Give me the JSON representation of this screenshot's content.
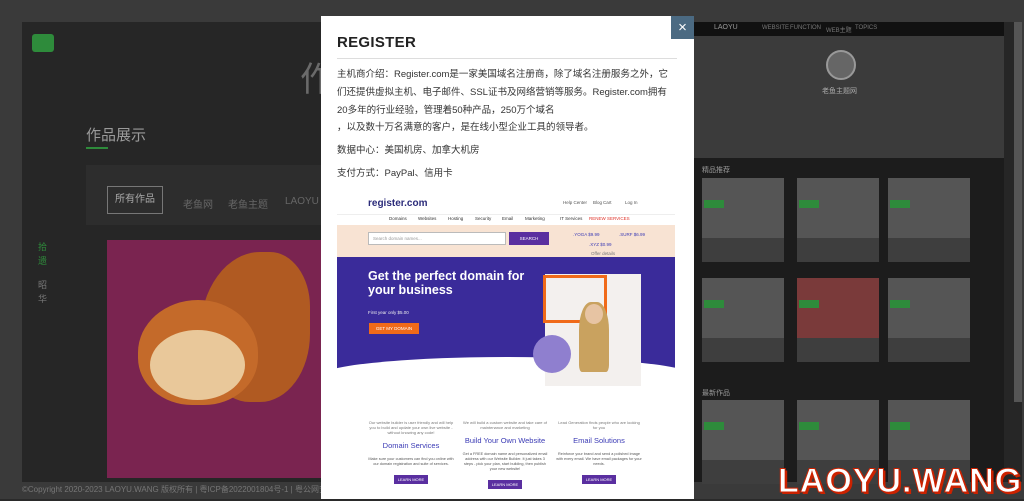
{
  "background": {
    "big_char": "作",
    "section_title": "作品展示",
    "filter": {
      "active": "所有作品",
      "items": [
        "老鱼网",
        "老鱼主题",
        "LAOYU"
      ]
    },
    "side_labels": [
      "拾",
      "遗",
      "昭",
      "华"
    ],
    "footer": "©Copyright 2020-2023 LAOYU.WANG 版权所有 | 粤ICP备2022001804号-1 | 粤公网安备 45070202000001号"
  },
  "right_site": {
    "logo": "LAOYU",
    "nav": [
      "WEBSITE",
      "FUNCTION",
      "WEB主题",
      "TOPICS"
    ],
    "profile_name": "老鱼主题网",
    "sections": [
      "精品推荐",
      "最新作品"
    ]
  },
  "modal": {
    "title": "REGISTER",
    "paragraphs": [
      "主机商介绍：Register.com是一家美国域名注册商，除了域名注册服务之外，它们还提供虚拟主机、电子邮件、SSL证书及网络营销等服务。Register.com拥有20多年的行业经验，管理着50种产品，250万个域名",
      "，以及数十万名满意的客户，是在线小型企业工具的领导者。",
      "数据中心：美国机房、加拿大机房",
      "支付方式：PayPal、信用卡"
    ],
    "close_label": "×"
  },
  "shot": {
    "logo": "register.com",
    "tools": [
      "Help Center",
      "Blog",
      "Cart",
      "Log In"
    ],
    "menu": [
      "Domains",
      "Websites",
      "Hosting",
      "Security",
      "Email",
      "Marketing",
      "IT Services",
      "RENEW SERVICES"
    ],
    "search_placeholder": "Search domain names...",
    "search_btn": "SEARCH",
    "prices": [
      ".YOGA $9.99",
      ".SURF $6.99",
      ".XYZ $0.99",
      "Offer details"
    ],
    "headline": "Get the perfect domain for your business",
    "offer": "First year only $5.00",
    "cta": "GET MY DOMAIN",
    "columns": [
      {
        "caption": "Our website builder is user friendly and will help you to build and update your own live website - without knowing any code!",
        "title": "Domain Services",
        "desc": "Make sure your customers can find you online with our domain registration and suite of services.",
        "btn": "LEARN MORE"
      },
      {
        "caption": "We will build a custom website and take care of maintenance and marketing",
        "title": "Build Your Own Website",
        "desc": "Get a FREE domain name and personalized email address with our Website Builder. It just takes 3 steps - pick your plan, start building, then publish your new website!",
        "btn": "LEARN MORE"
      },
      {
        "caption": "Lead Generation finds people who are looking for you",
        "title": "Email Solutions",
        "desc": "Reinforce your brand and send a polished image with every email. We have email packages for your needs.",
        "btn": "LEARN MORE"
      }
    ]
  },
  "watermark": "LAOYU.WANG"
}
